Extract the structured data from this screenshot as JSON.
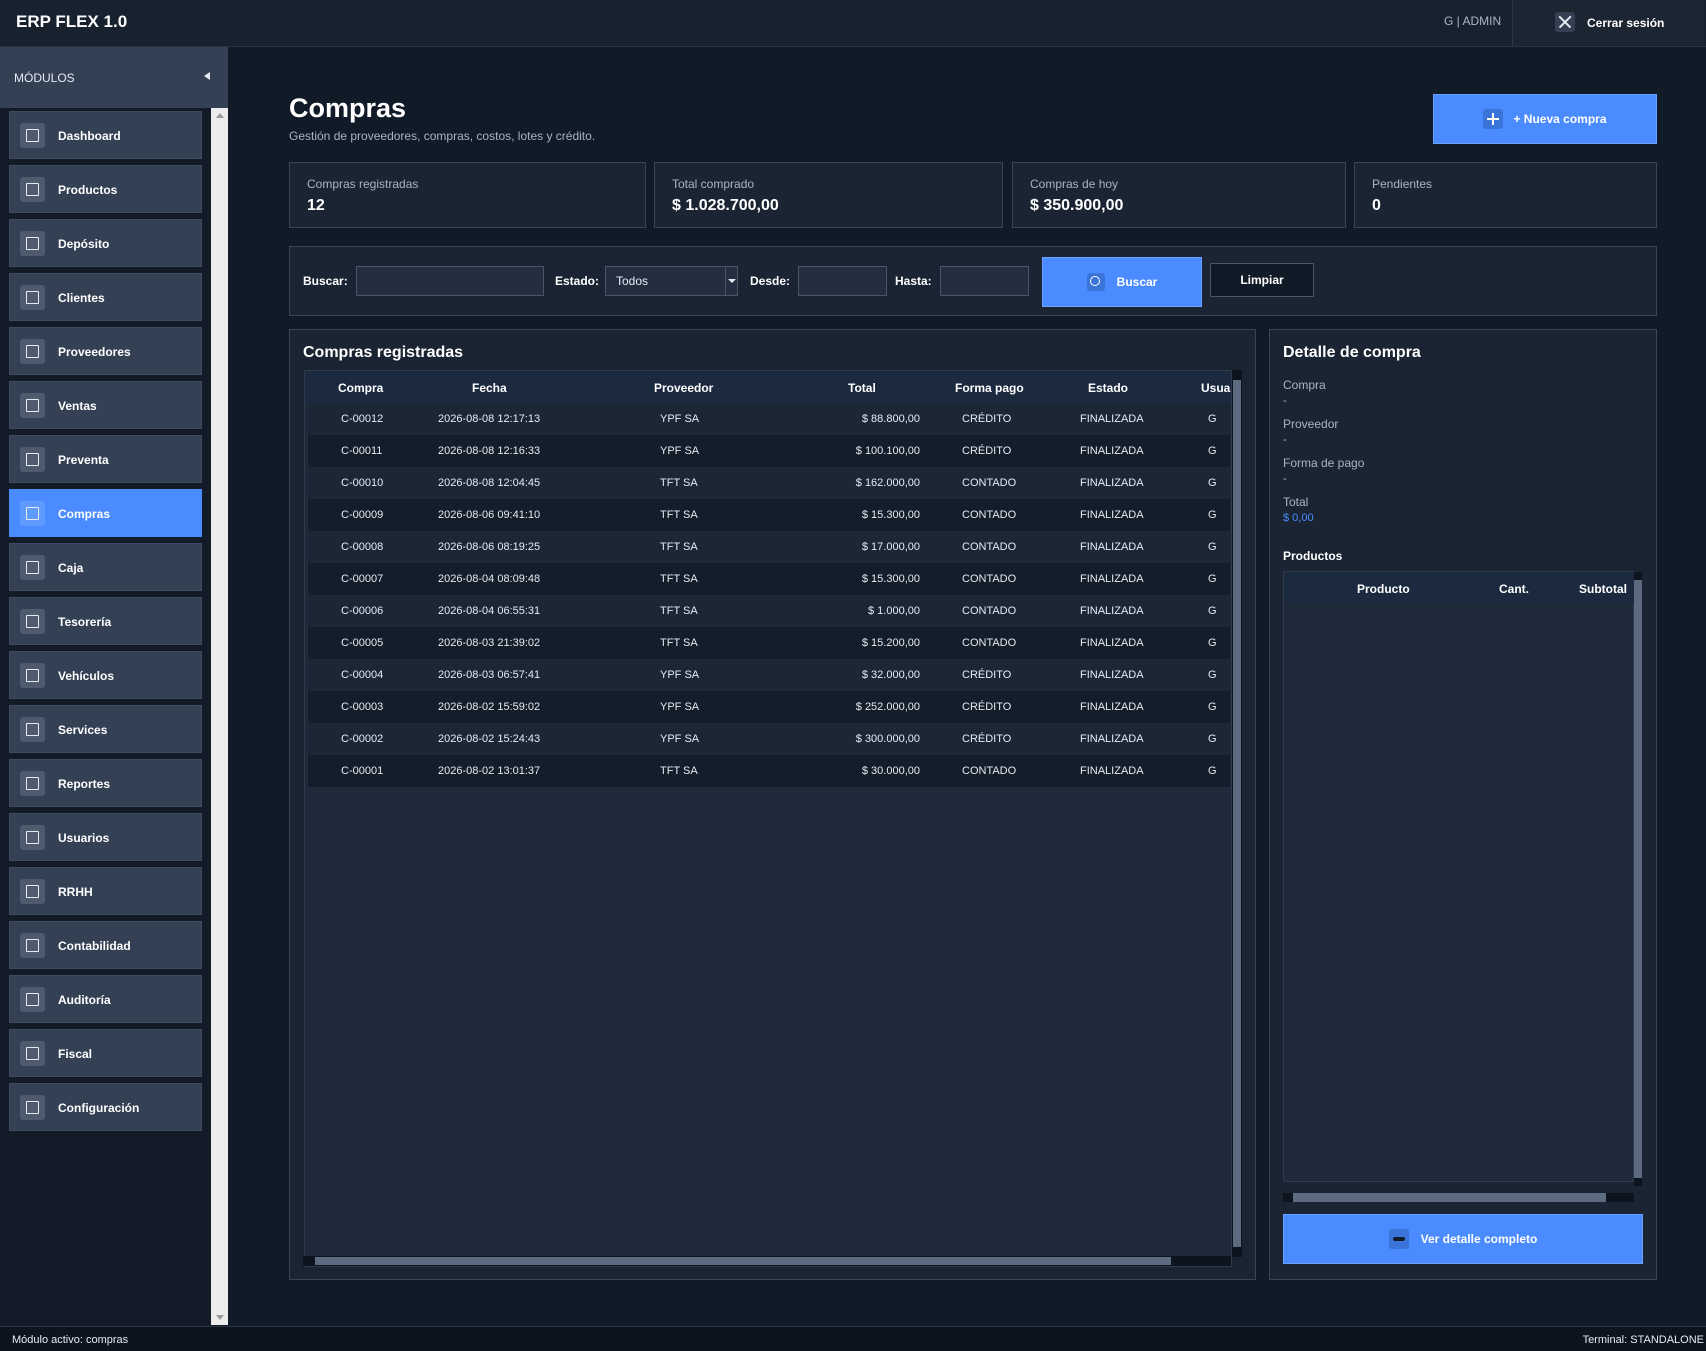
{
  "app": {
    "title": "ERP FLEX 1.0",
    "user": "G | ADMIN",
    "logout_label": "Cerrar sesión",
    "logout_icon": "close-icon"
  },
  "sidebar": {
    "header": "MÓDULOS",
    "items": [
      {
        "label": "Dashboard",
        "icon": "dashboard-icon",
        "active": false
      },
      {
        "label": "Productos",
        "icon": "box-icon",
        "active": false
      },
      {
        "label": "Depósito",
        "icon": "warehouse-icon",
        "active": false
      },
      {
        "label": "Clientes",
        "icon": "people-icon",
        "active": false
      },
      {
        "label": "Proveedores",
        "icon": "people-icon",
        "active": false
      },
      {
        "label": "Ventas",
        "icon": "cart-icon",
        "active": false
      },
      {
        "label": "Preventa",
        "icon": "cart-icon",
        "active": false
      },
      {
        "label": "Compras",
        "icon": "bag-icon",
        "active": true
      },
      {
        "label": "Caja",
        "icon": "cash-register-icon",
        "active": false
      },
      {
        "label": "Tesorería",
        "icon": "bank-icon",
        "active": false
      },
      {
        "label": "Vehículos",
        "icon": "truck-icon",
        "active": false
      },
      {
        "label": "Services",
        "icon": "wrench-icon",
        "active": false
      },
      {
        "label": "Reportes",
        "icon": "bar-chart-icon",
        "active": false
      },
      {
        "label": "Usuarios",
        "icon": "people-icon",
        "active": false
      },
      {
        "label": "RRHH",
        "icon": "person-icon",
        "active": false
      },
      {
        "label": "Contabilidad",
        "icon": "ledger-icon",
        "active": false
      },
      {
        "label": "Auditoría",
        "icon": "bar-chart-icon",
        "active": false
      },
      {
        "label": "Fiscal",
        "icon": "document-icon",
        "active": false
      },
      {
        "label": "Configuración",
        "icon": "gear-icon",
        "active": false
      }
    ]
  },
  "header": {
    "title": "Compras",
    "subtitle": "Gestión de proveedores, compras, costos, lotes y crédito.",
    "new_button": "+ Nueva compra",
    "new_icon": "plus-icon"
  },
  "stats": [
    {
      "label": "Compras registradas",
      "value": "12"
    },
    {
      "label": "Total comprado",
      "value": "$ 1.028.700,00"
    },
    {
      "label": "Compras de hoy",
      "value": "$ 350.900,00"
    },
    {
      "label": "Pendientes",
      "value": "0"
    }
  ],
  "filters": {
    "search_label": "Buscar:",
    "search_value": "",
    "status_label": "Estado:",
    "status_value": "Todos",
    "from_label": "Desde:",
    "from_value": "",
    "to_label": "Hasta:",
    "to_value": "",
    "search_button": "Buscar",
    "search_icon": "search-icon",
    "clear_button": "Limpiar"
  },
  "purchases": {
    "title": "Compras registradas",
    "columns": [
      "Compra",
      "Fecha",
      "Proveedor",
      "Total",
      "Forma pago",
      "Estado",
      "Usua"
    ],
    "rows": [
      [
        "C-00012",
        "2026-08-08 12:17:13",
        "YPF SA",
        "$ 88.800,00",
        "CRÉDITO",
        "FINALIZADA",
        "G"
      ],
      [
        "C-00011",
        "2026-08-08 12:16:33",
        "YPF SA",
        "$ 100.100,00",
        "CRÉDITO",
        "FINALIZADA",
        "G"
      ],
      [
        "C-00010",
        "2026-08-08 12:04:45",
        "TFT SA",
        "$ 162.000,00",
        "CONTADO",
        "FINALIZADA",
        "G"
      ],
      [
        "C-00009",
        "2026-08-06 09:41:10",
        "TFT SA",
        "$ 15.300,00",
        "CONTADO",
        "FINALIZADA",
        "G"
      ],
      [
        "C-00008",
        "2026-08-06 08:19:25",
        "TFT SA",
        "$ 17.000,00",
        "CONTADO",
        "FINALIZADA",
        "G"
      ],
      [
        "C-00007",
        "2026-08-04 08:09:48",
        "TFT SA",
        "$ 15.300,00",
        "CONTADO",
        "FINALIZADA",
        "G"
      ],
      [
        "C-00006",
        "2026-08-04 06:55:31",
        "TFT SA",
        "$ 1.000,00",
        "CONTADO",
        "FINALIZADA",
        "G"
      ],
      [
        "C-00005",
        "2026-08-03 21:39:02",
        "TFT SA",
        "$ 15.200,00",
        "CONTADO",
        "FINALIZADA",
        "G"
      ],
      [
        "C-00004",
        "2026-08-03 06:57:41",
        "YPF SA",
        "$ 32.000,00",
        "CRÉDITO",
        "FINALIZADA",
        "G"
      ],
      [
        "C-00003",
        "2026-08-02 15:59:02",
        "YPF SA",
        "$ 252.000,00",
        "CRÉDITO",
        "FINALIZADA",
        "G"
      ],
      [
        "C-00002",
        "2026-08-02 15:24:43",
        "YPF SA",
        "$ 300.000,00",
        "CRÉDITO",
        "FINALIZADA",
        "G"
      ],
      [
        "C-00001",
        "2026-08-02 13:01:37",
        "TFT SA",
        "$ 30.000,00",
        "CONTADO",
        "FINALIZADA",
        "G"
      ]
    ]
  },
  "detail": {
    "title": "Detalle de compra",
    "fields": [
      {
        "label": "Compra",
        "value": "-"
      },
      {
        "label": "Proveedor",
        "value": "-"
      },
      {
        "label": "Forma de pago",
        "value": "-"
      },
      {
        "label": "Total",
        "value": "$ 0,00"
      }
    ],
    "products_title": "Productos",
    "product_columns": [
      "Producto",
      "Cant.",
      "Subtotal"
    ],
    "view_button": "Ver detalle completo",
    "view_icon": "eye-icon"
  },
  "status": {
    "left": "Módulo activo: compras",
    "right": "Terminal: STANDALONE"
  },
  "colors": {
    "accent": "#4a8cff",
    "background": "#111a27",
    "panel": "#1a2433",
    "sidebar_item": "#344155"
  }
}
